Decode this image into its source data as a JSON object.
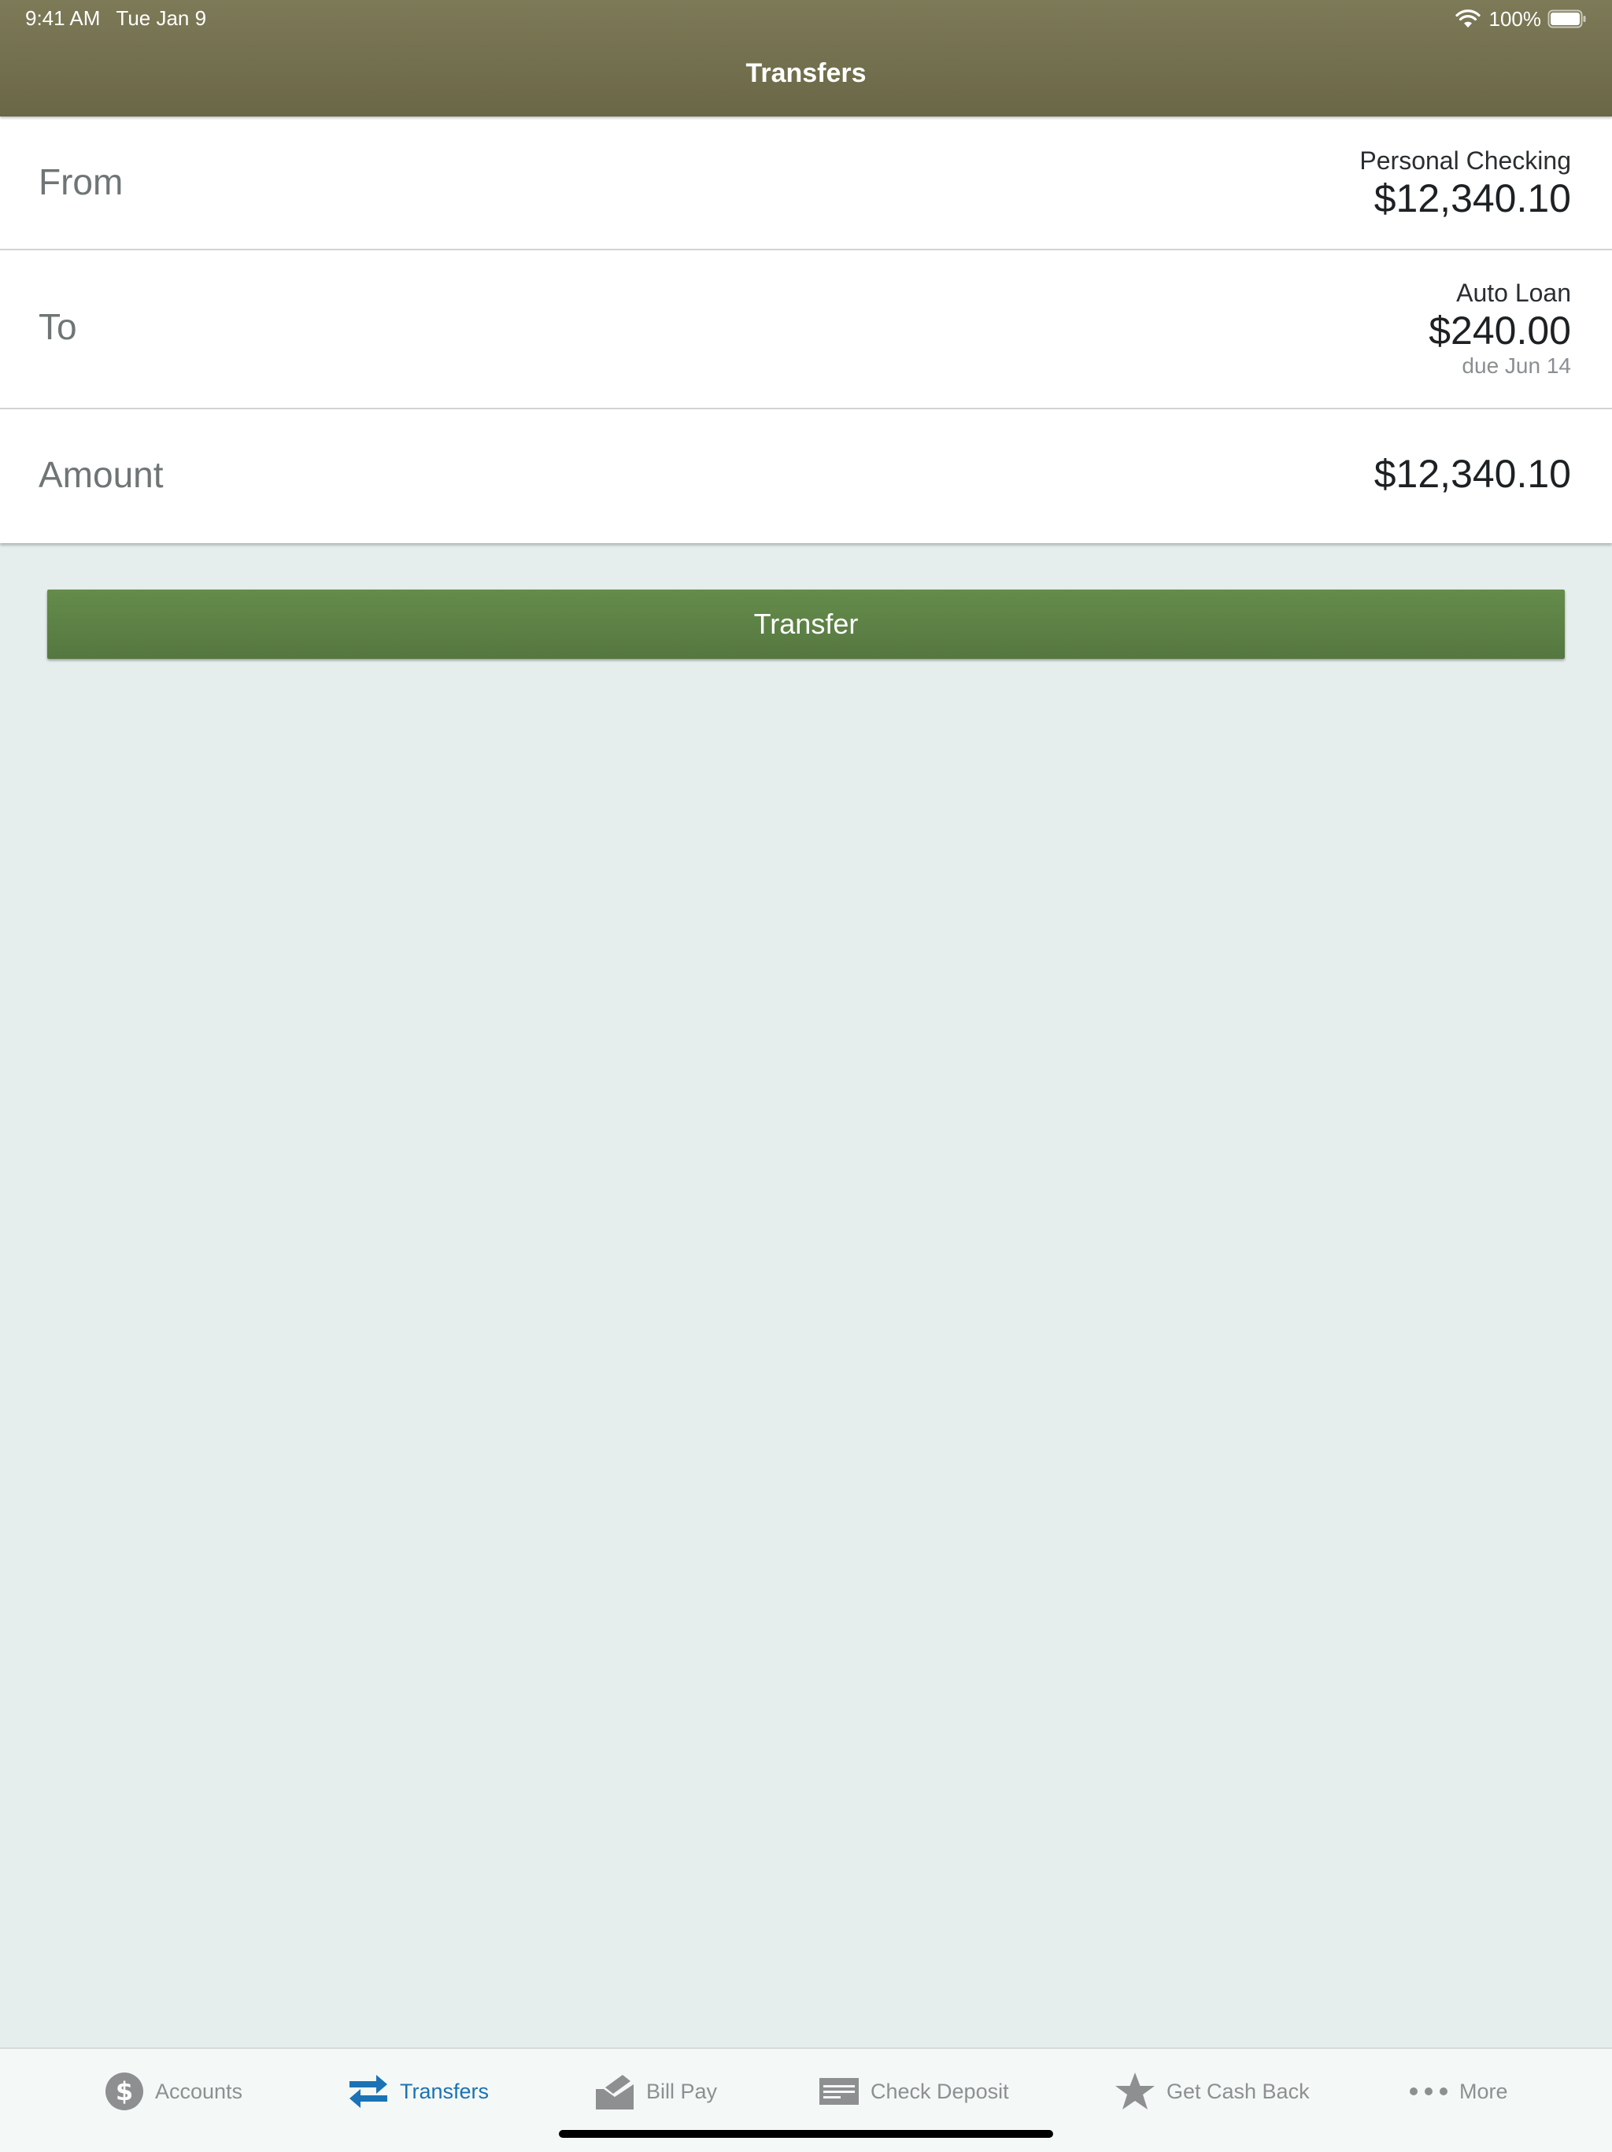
{
  "status_bar": {
    "time": "9:41 AM",
    "date": "Tue Jan 9",
    "battery": "100%"
  },
  "header": {
    "title": "Transfers"
  },
  "form": {
    "from": {
      "label": "From",
      "account_name": "Personal Checking",
      "amount": "$12,340.10"
    },
    "to": {
      "label": "To",
      "account_name": "Auto Loan",
      "amount": "$240.00",
      "due": "due Jun 14"
    },
    "amount": {
      "label": "Amount",
      "value": "$12,340.10"
    }
  },
  "transfer_button": {
    "label": "Transfer"
  },
  "tab_bar": {
    "tabs": [
      {
        "label": "Accounts",
        "icon": "dollar-circle-icon",
        "active": false
      },
      {
        "label": "Transfers",
        "icon": "transfer-arrows-icon",
        "active": true
      },
      {
        "label": "Bill Pay",
        "icon": "bill-pay-icon",
        "active": false
      },
      {
        "label": "Check Deposit",
        "icon": "check-icon",
        "active": false
      },
      {
        "label": "Get Cash Back",
        "icon": "star-icon",
        "active": false
      },
      {
        "label": "More",
        "icon": "more-dots-icon",
        "active": false
      }
    ]
  },
  "colors": {
    "header": "#736f4f",
    "button": "#5e8446",
    "active_tab": "#1b73b5",
    "inactive_tab": "#8e8f91",
    "background": "#e6eeed"
  }
}
